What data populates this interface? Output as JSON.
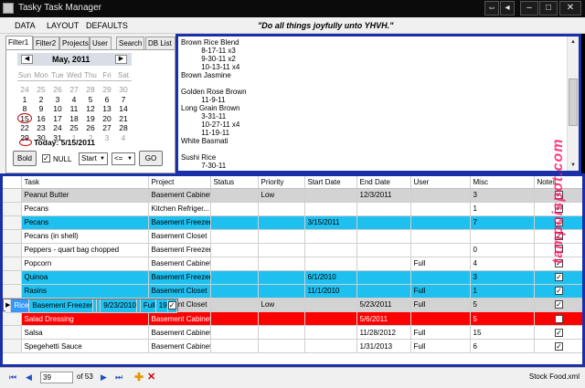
{
  "window": {
    "title": "Tasky Task Manager",
    "controls": [
      "⇔",
      "◂",
      "–",
      "□",
      "✕"
    ]
  },
  "menu": {
    "items": [
      "DATA",
      "LAYOUT",
      "DEFAULTS"
    ],
    "motto": "\"Do all things joyfully unto YHVH.\""
  },
  "filter_tabs": [
    "Filter1",
    "Filter2",
    "Projects",
    "User",
    "Search",
    "DB List"
  ],
  "calendar": {
    "month_label": "May, 2011",
    "prev": "◀",
    "next": "▶",
    "weekdays": [
      "Sun",
      "Mon",
      "Tue",
      "Wed",
      "Thu",
      "Fri",
      "Sat"
    ],
    "weeks": [
      [
        "24",
        "25",
        "26",
        "27",
        "28",
        "29",
        "30"
      ],
      [
        "1",
        "2",
        "3",
        "4",
        "5",
        "6",
        "7"
      ],
      [
        "8",
        "9",
        "10",
        "11",
        "12",
        "13",
        "14"
      ],
      [
        "15",
        "16",
        "17",
        "18",
        "19",
        "20",
        "21"
      ],
      [
        "22",
        "23",
        "24",
        "25",
        "26",
        "27",
        "28"
      ],
      [
        "29",
        "30",
        "31",
        "1",
        "2",
        "3",
        "4"
      ]
    ],
    "today_text": "Today: 5/15/2011"
  },
  "controls": {
    "bold_label": "Bold",
    "null_label": "NULL",
    "null_checked": "✓",
    "field_select": "Start",
    "op_select": "<=",
    "go_label": "GO"
  },
  "notes_text": [
    "Brown Rice Blend",
    "          8-17-11 x3",
    "          9-30-11 x2",
    "          10-13-11 x4",
    "Brown Jasmine",
    "",
    "Golden Rose Brown",
    "          11-9-11",
    "Long Grain Brown",
    "          3-31-11",
    "          10-27-11 x4",
    "          11-19-11",
    "White Basmati",
    "",
    "Sushi Rice",
    "          7-30-11",
    "          10-20-11"
  ],
  "grid": {
    "columns": [
      "",
      "Task",
      "Project",
      "Status",
      "Priority",
      "Start Date",
      "End Date",
      "User",
      "Misc",
      "Notes"
    ],
    "rows": [
      {
        "style": "gray",
        "indicator": "",
        "cells": [
          "Peanut Butter",
          "Basement Cabinet",
          "",
          "Low",
          "",
          "12/3/2011",
          "",
          "3"
        ],
        "notes": "✓"
      },
      {
        "style": "",
        "indicator": "",
        "cells": [
          "Pecans",
          "Kitchen Refriger...",
          "",
          "",
          "",
          "",
          "",
          "1"
        ],
        "notes": "✓"
      },
      {
        "style": "blue",
        "indicator": "",
        "cells": [
          "Pecans",
          "Basement Freezer",
          "",
          "",
          "3/15/2011",
          "",
          "",
          "7"
        ],
        "notes": "✓"
      },
      {
        "style": "",
        "indicator": "",
        "cells": [
          "Pecans (in shell)",
          "Basement Closet",
          "",
          "",
          "",
          "",
          "",
          ""
        ],
        "notes": "✓"
      },
      {
        "style": "",
        "indicator": "",
        "cells": [
          "Peppers - quart bag chopped",
          "Basement Freezer",
          "",
          "",
          "",
          "",
          "",
          "0"
        ],
        "notes": ""
      },
      {
        "style": "",
        "indicator": "",
        "cells": [
          "Popcorn",
          "Basement Cabinet",
          "",
          "",
          "",
          "",
          "Full",
          "4"
        ],
        "notes": "✓"
      },
      {
        "style": "blue",
        "indicator": "",
        "cells": [
          "Quinoa",
          "Basement Freezer",
          "",
          "",
          "6/1/2010",
          "",
          "",
          "3"
        ],
        "notes": "✓"
      },
      {
        "style": "blue",
        "indicator": "",
        "cells": [
          "Rasins",
          "Basement Closet",
          "",
          "",
          "11/1/2010",
          "",
          "Full",
          "1"
        ],
        "notes": "✓"
      },
      {
        "style": "blue sel",
        "indicator": "▶",
        "cells": [
          "Rice",
          "Basement Freezer",
          "",
          "",
          "9/23/2010",
          "",
          "Full",
          "19"
        ],
        "notes": "✓"
      },
      {
        "style": "gray",
        "indicator": "",
        "cells": [
          "Rice Cakes",
          "Basement Closet",
          "",
          "Low",
          "",
          "5/23/2011",
          "Full",
          "5"
        ],
        "notes": "✓"
      },
      {
        "style": "red",
        "indicator": "",
        "cells": [
          "Salad Dressing",
          "Basement Cabinet",
          "",
          "",
          "",
          "5/6/2011",
          "",
          "5"
        ],
        "notes": "✓"
      },
      {
        "style": "",
        "indicator": "",
        "cells": [
          "Salsa",
          "Basement Cabinet",
          "",
          "",
          "",
          "11/28/2012",
          "Full",
          "15"
        ],
        "notes": "✓"
      },
      {
        "style": "",
        "indicator": "",
        "cells": [
          "Spegehetti Sauce",
          "Basement Cabinet",
          "",
          "",
          "",
          "1/31/2013",
          "Full",
          "6"
        ],
        "notes": "✓"
      }
    ]
  },
  "navigator": {
    "position": "39",
    "of_count": "of 53",
    "first": "⏮",
    "prev": "◀",
    "next": "▶",
    "last": "⏭",
    "add": "✚",
    "delete": "✕"
  },
  "status": {
    "filename": "Stock Food.xml"
  },
  "watermark": "tampoispot.com"
}
